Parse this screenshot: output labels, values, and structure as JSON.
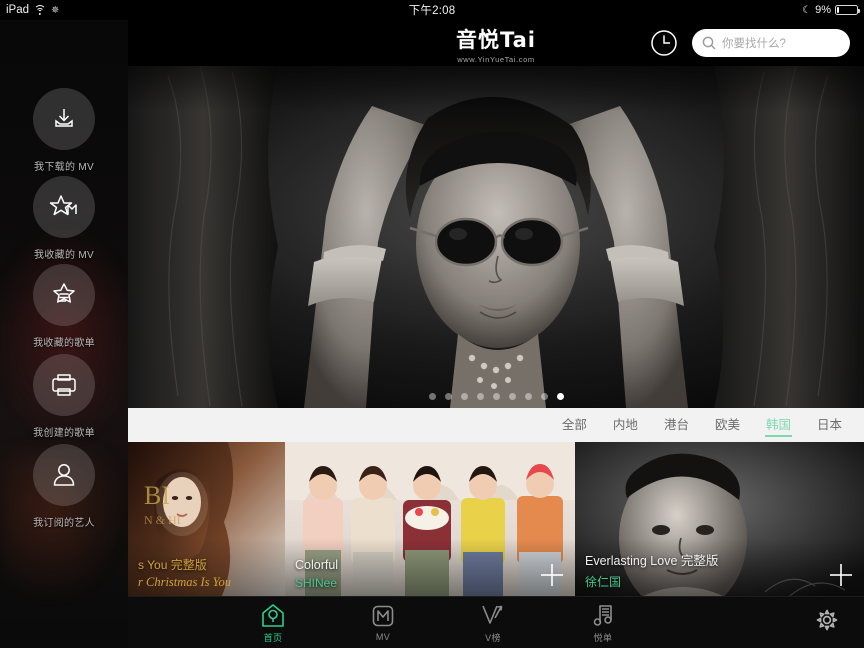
{
  "statusbar": {
    "carrier": "iPad",
    "wifi_icon": "wifi-icon",
    "location_icon": "location-icon",
    "time": "下午2:08",
    "moon_icon": "do-not-disturb-icon",
    "battery_percent": "9%",
    "battery_icon": "battery-icon"
  },
  "sidebar": {
    "items": [
      {
        "label": "我下载的 MV",
        "icon": "download-icon"
      },
      {
        "label": "我收藏的 MV",
        "icon": "star-mv-icon"
      },
      {
        "label": "我收藏的歌单",
        "icon": "star-playlist-icon"
      },
      {
        "label": "我创建的歌单",
        "icon": "create-playlist-icon"
      },
      {
        "label": "我订阅的艺人",
        "icon": "person-icon"
      }
    ]
  },
  "header": {
    "logo_main": "音悦Tai",
    "logo_sub": "www.YinYueTai.com",
    "history_icon": "clock-icon",
    "search_icon": "search-icon",
    "search_placeholder": "你要找什么?",
    "search_value": ""
  },
  "hero": {
    "dots_total": 9,
    "active_dot_index": 8
  },
  "filters": {
    "tabs": [
      {
        "label": "全部",
        "active": false
      },
      {
        "label": "内地",
        "active": false
      },
      {
        "label": "港台",
        "active": false
      },
      {
        "label": "欧美",
        "active": false
      },
      {
        "label": "韩国",
        "active": true
      },
      {
        "label": "日本",
        "active": false
      }
    ],
    "active_color": "#7ed9b2"
  },
  "cards": [
    {
      "title": "s You 完整版",
      "subtitle": "r Christmas Is You",
      "artist": "",
      "plus_icon": "add-icon"
    },
    {
      "title": "Colorful",
      "subtitle": "",
      "artist": "SHINee",
      "plus_icon": "add-icon"
    },
    {
      "title": "Everlasting Love 完整版",
      "subtitle": "",
      "artist": "徐仁国",
      "plus_icon": "add-icon"
    }
  ],
  "tabbar": {
    "items": [
      {
        "label": "首页",
        "icon": "home-icon",
        "active": true
      },
      {
        "label": "MV",
        "icon": "mv-icon",
        "active": false
      },
      {
        "label": "V榜",
        "icon": "vchart-icon",
        "active": false
      },
      {
        "label": "悦单",
        "icon": "playlist-note-icon",
        "active": false
      }
    ],
    "settings_icon": "gear-icon",
    "active_color": "#2ecf8d"
  }
}
